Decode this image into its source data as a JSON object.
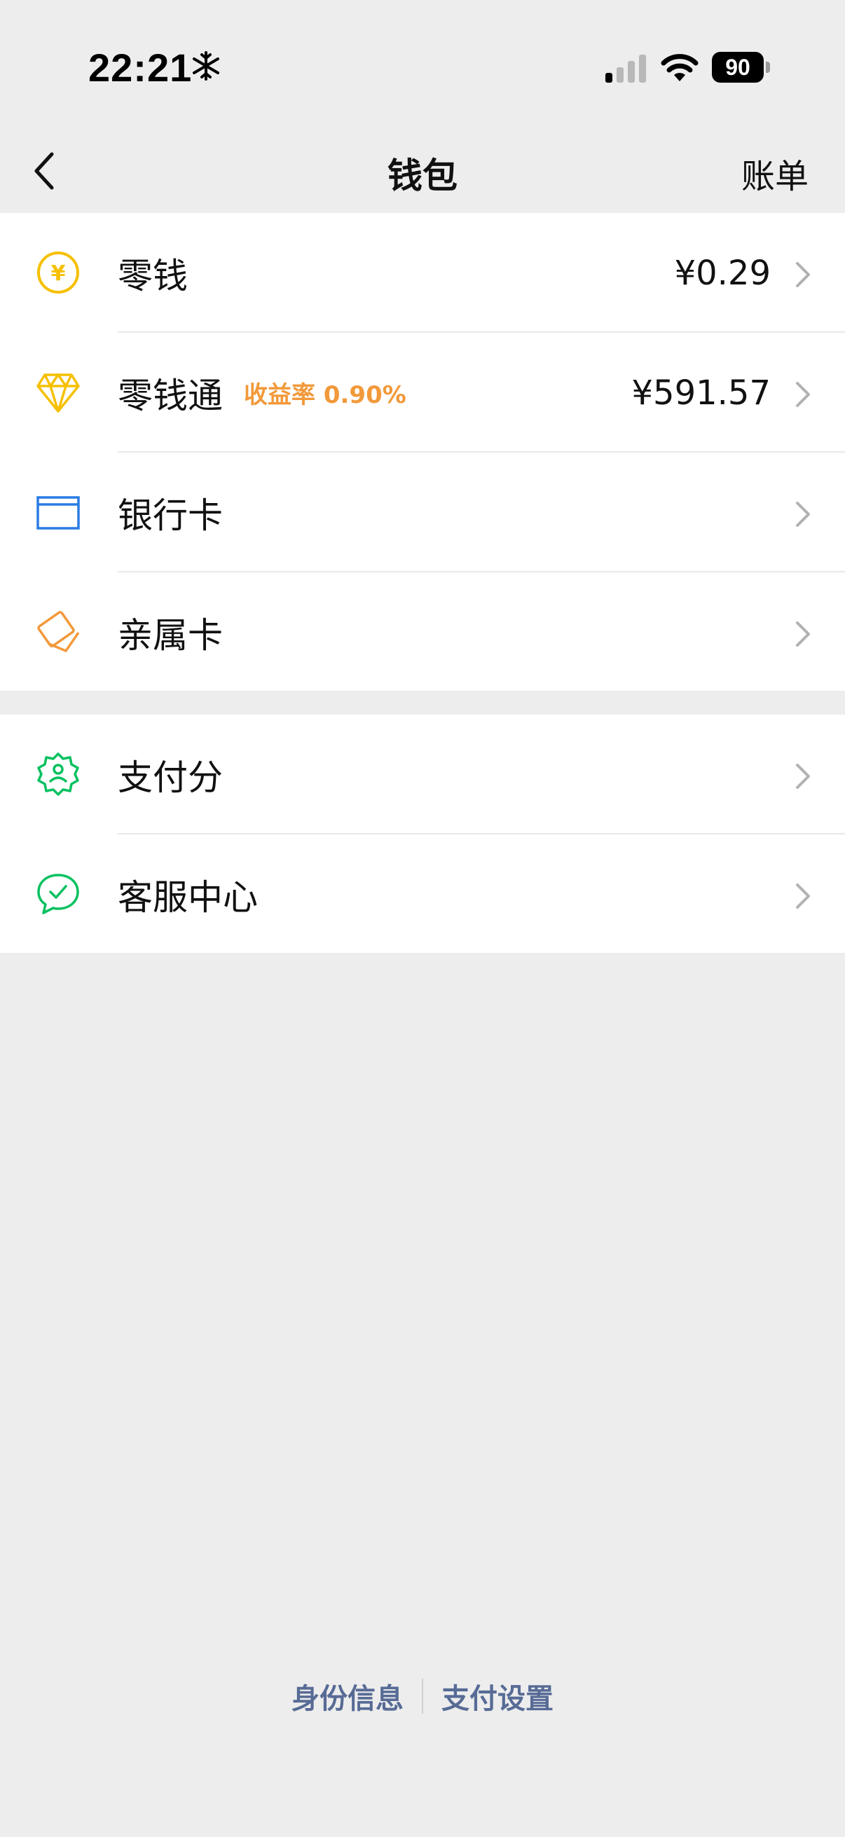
{
  "status_bar": {
    "time": "22:21",
    "battery": "90",
    "icons": [
      "snowflake-icon",
      "signal-icon",
      "wifi-icon",
      "battery-icon"
    ]
  },
  "nav": {
    "title": "钱包",
    "right_action": "账单",
    "back_icon": "chevron-left-icon"
  },
  "sections": [
    {
      "items": [
        {
          "label": "零钱",
          "value": "¥0.29",
          "icon": "yuan-coin-icon",
          "color": "#f5c000"
        },
        {
          "label": "零钱通",
          "badge": "收益率 0.90%",
          "value": "¥591.57",
          "icon": "diamond-icon",
          "color": "#f5c000"
        },
        {
          "label": "银行卡",
          "value": "",
          "icon": "bank-card-icon",
          "color": "#2a7be4"
        },
        {
          "label": "亲属卡",
          "value": "",
          "icon": "family-card-icon",
          "color": "#f2993a"
        }
      ]
    },
    {
      "items": [
        {
          "label": "支付分",
          "value": "",
          "icon": "pay-score-badge-icon",
          "color": "#07c160"
        },
        {
          "label": "客服中心",
          "value": "",
          "icon": "customer-service-icon",
          "color": "#07c160"
        }
      ]
    }
  ],
  "footer": {
    "links": [
      "身份信息",
      "支付设置"
    ],
    "color": "#576b95"
  }
}
